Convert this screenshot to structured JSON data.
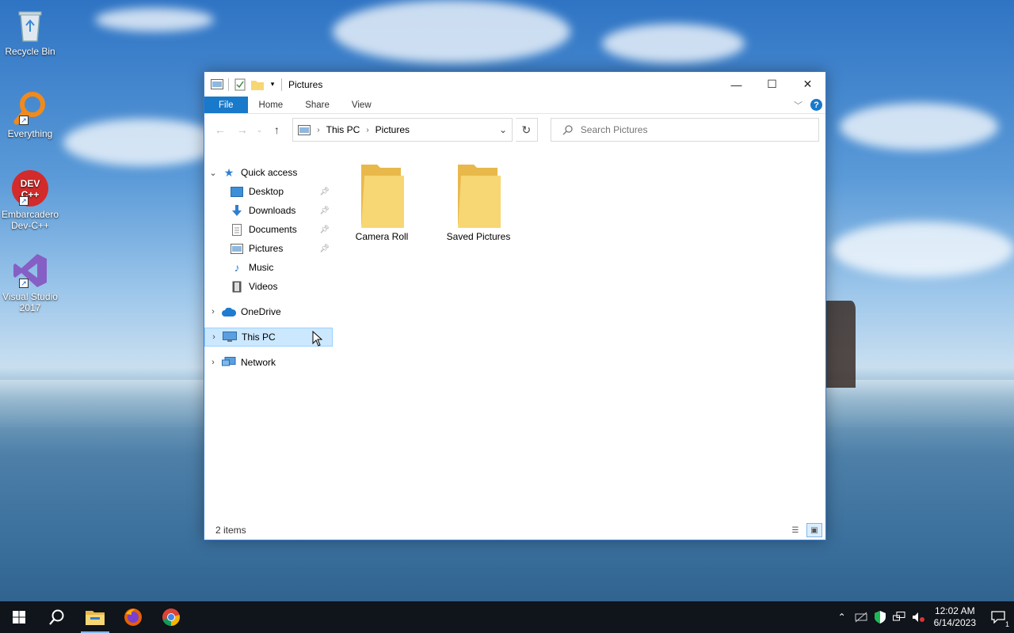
{
  "desktop": {
    "icons": [
      {
        "label": "Recycle Bin",
        "icon": "recycle-bin-icon"
      },
      {
        "label": "Everything",
        "icon": "everything-search-icon"
      },
      {
        "label": "Embarcadero Dev-C++",
        "icon": "dev-cpp-icon"
      },
      {
        "label": "Visual Studio 2017",
        "icon": "visual-studio-icon"
      }
    ],
    "devcpp_logo_text": "DEV C++"
  },
  "window": {
    "title": "Pictures",
    "controls": {
      "minimize": "—",
      "maximize": "☐",
      "close": "✕"
    },
    "ribbon": {
      "tabs": [
        "File",
        "Home",
        "Share",
        "View"
      ]
    },
    "address": {
      "crumbs": [
        "This PC",
        "Pictures"
      ]
    },
    "search": {
      "placeholder": "Search Pictures"
    },
    "nav": {
      "quick_access": "Quick access",
      "quick_items": [
        {
          "label": "Desktop",
          "pinned": true
        },
        {
          "label": "Downloads",
          "pinned": true
        },
        {
          "label": "Documents",
          "pinned": true
        },
        {
          "label": "Pictures",
          "pinned": true
        },
        {
          "label": "Music",
          "pinned": false
        },
        {
          "label": "Videos",
          "pinned": false
        }
      ],
      "onedrive": "OneDrive",
      "this_pc": "This PC",
      "network": "Network"
    },
    "folders": [
      {
        "label": "Camera Roll"
      },
      {
        "label": "Saved Pictures"
      }
    ],
    "status": {
      "item_count": "2 items"
    }
  },
  "taskbar": {
    "apps": [
      "start",
      "search",
      "file-explorer",
      "firefox",
      "chrome"
    ],
    "clock": {
      "time": "12:02 AM",
      "date": "6/14/2023"
    },
    "notification_count": "1"
  },
  "colors": {
    "accent": "#1979ca",
    "selection": "#cce8ff",
    "folder": "#f7d674",
    "taskbar": "#10141b"
  }
}
